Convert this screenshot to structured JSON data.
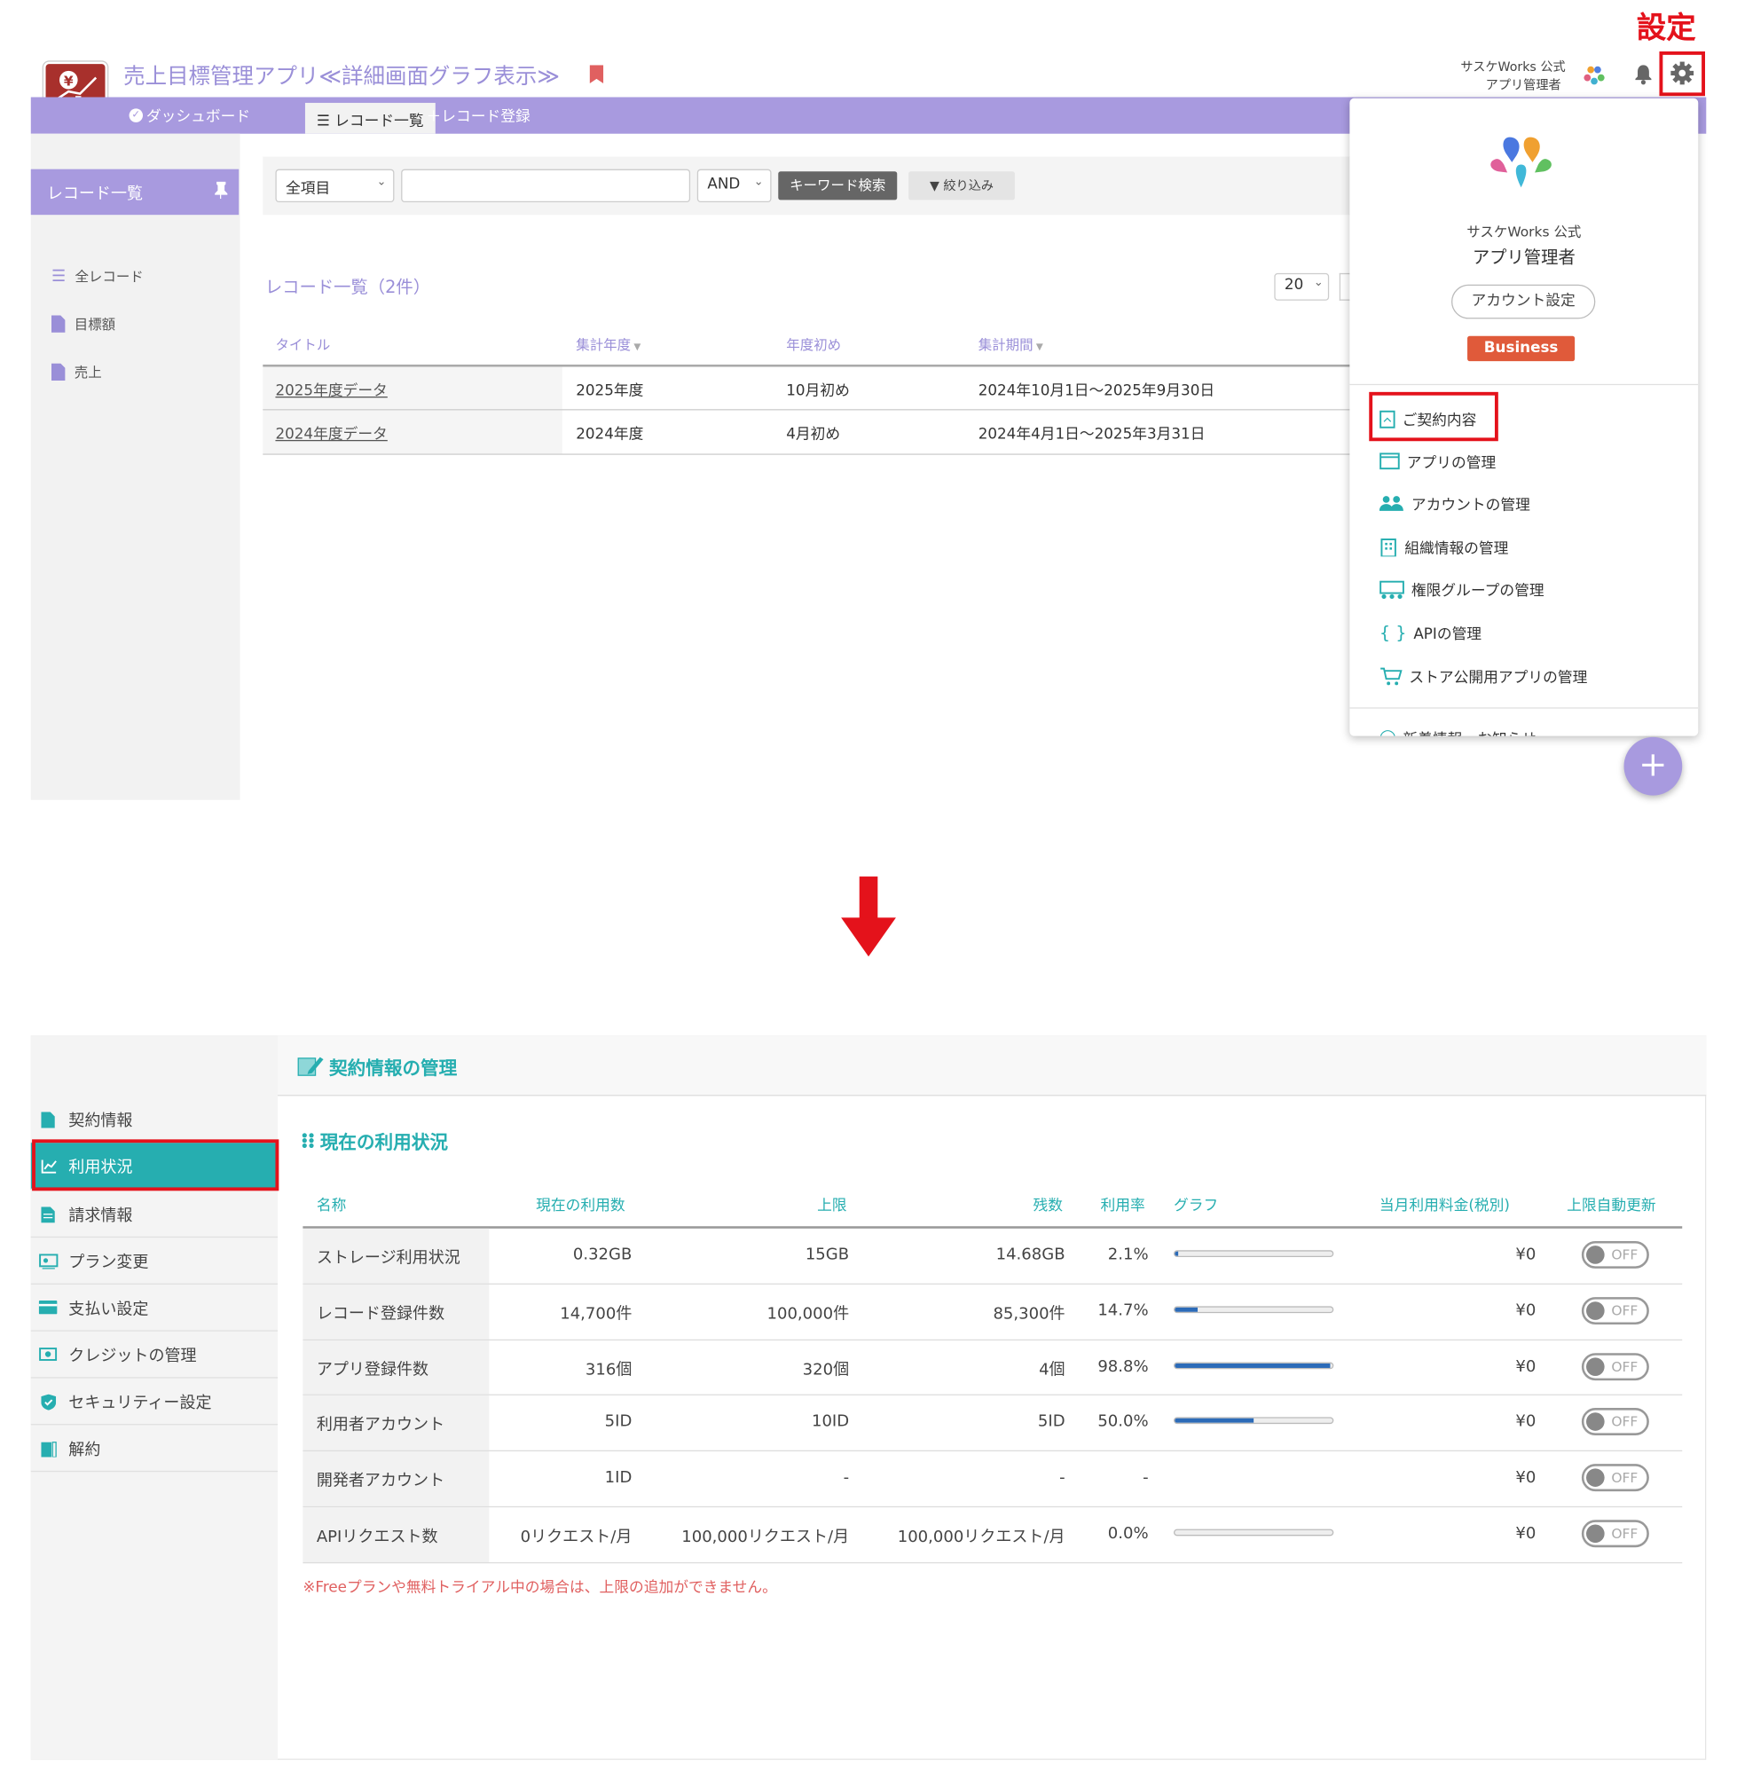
{
  "annotation": {
    "settings_label": "設定"
  },
  "top": {
    "app_title": "売上目標管理アプリ≪詳細画面グラフ表示≫",
    "user_org": "サスケWorks 公式",
    "user_name": "アプリ管理者",
    "nav": {
      "dashboard": "ダッシュボード",
      "record_list": "レコード一覧",
      "record_add": "レコード登録"
    },
    "sidebar": {
      "header": "レコード一覧",
      "items": [
        {
          "label": "全レコード"
        },
        {
          "label": "目標額"
        },
        {
          "label": "売上"
        }
      ]
    },
    "search": {
      "field_select": "全項目",
      "keyword_value": "",
      "operator_select": "AND",
      "keyword_button": "キーワード検索",
      "filter_button": "絞り込み"
    },
    "records_title": "レコード一覧（2件）",
    "page_size": "20",
    "table": {
      "headers": [
        "タイトル",
        "集計年度",
        "年度初め",
        "集計期間"
      ],
      "rows": [
        [
          "2025年度データ",
          "2025年度",
          "10月初め",
          "2024年10月1日〜2025年9月30日"
        ],
        [
          "2024年度データ",
          "2024年度",
          "4月初め",
          "2024年4月1日〜2025年3月31日"
        ]
      ]
    },
    "menu": {
      "org": "サスケWorks 公式",
      "name": "アプリ管理者",
      "account_settings": "アカウント設定",
      "plan_badge": "Business",
      "items": [
        {
          "label": "ご契約内容",
          "icon": "contract-icon"
        },
        {
          "label": "アプリの管理",
          "icon": "window-icon"
        },
        {
          "label": "アカウントの管理",
          "icon": "users-icon"
        },
        {
          "label": "組織情報の管理",
          "icon": "building-icon"
        },
        {
          "label": "権限グループの管理",
          "icon": "group-icon"
        },
        {
          "label": "APIの管理",
          "icon": "braces-icon"
        },
        {
          "label": "ストア公開用アプリの管理",
          "icon": "cart-icon"
        }
      ],
      "cut_item": "新着情報・お知らせ"
    }
  },
  "bottom": {
    "page_title": "契約情報の管理",
    "section_title": "現在の利用状況",
    "sidebar": [
      {
        "label": "契約情報"
      },
      {
        "label": "利用状況"
      },
      {
        "label": "請求情報"
      },
      {
        "label": "プラン変更"
      },
      {
        "label": "支払い設定"
      },
      {
        "label": "クレジットの管理"
      },
      {
        "label": "セキュリティー設定"
      },
      {
        "label": "解約"
      }
    ],
    "usage_headers": [
      "名称",
      "現在の利用数",
      "上限",
      "残数",
      "利用率",
      "グラフ",
      "当月利用料金(税別)",
      "上限自動更新"
    ],
    "usage_rows": [
      {
        "name": "ストレージ利用状況",
        "current": "0.32GB",
        "limit": "15GB",
        "remaining": "14.68GB",
        "rate": "2.1%",
        "rate_value": 0.021,
        "fee": "¥0",
        "auto": "OFF"
      },
      {
        "name": "レコード登録件数",
        "current": "14,700件",
        "limit": "100,000件",
        "remaining": "85,300件",
        "rate": "14.7%",
        "rate_value": 0.147,
        "fee": "¥0",
        "auto": "OFF"
      },
      {
        "name": "アプリ登録件数",
        "current": "316個",
        "limit": "320個",
        "remaining": "4個",
        "rate": "98.8%",
        "rate_value": 0.988,
        "fee": "¥0",
        "auto": "OFF"
      },
      {
        "name": "利用者アカウント",
        "current": "5ID",
        "limit": "10ID",
        "remaining": "5ID",
        "rate": "50.0%",
        "rate_value": 0.5,
        "fee": "¥0",
        "auto": "OFF"
      },
      {
        "name": "開発者アカウント",
        "current": "1ID",
        "limit": "-",
        "remaining": "-",
        "rate": "-",
        "rate_value": null,
        "fee": "¥0",
        "auto": "OFF"
      },
      {
        "name": "APIリクエスト数",
        "current": "0リクエスト/月",
        "limit": "100,000リクエスト/月",
        "remaining": "100,000リクエスト/月",
        "rate": "0.0%",
        "rate_value": 0.0,
        "fee": "¥0",
        "auto": "OFF"
      }
    ],
    "note": "※Freeプランや無料トライアル中の場合は、上限の追加ができません。"
  },
  "colors": {
    "accent_purple": "#a89adf",
    "teal": "#26aeb0",
    "highlight_red": "#e4121b",
    "plan_badge": "#e05a3a",
    "bar_blue": "#2c6bb8"
  }
}
